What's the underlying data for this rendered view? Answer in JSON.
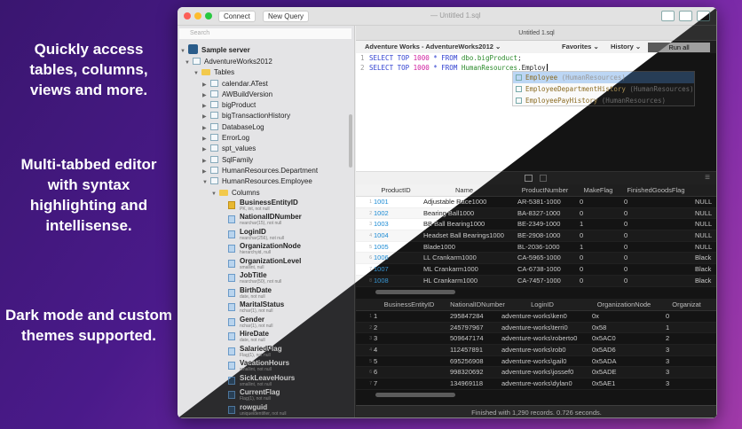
{
  "promo": [
    "Quickly access tables, columns, views and more.",
    "Multi-tabbed editor with syntax highlighting and intellisense.",
    "Dark mode and custom themes supported."
  ],
  "window": {
    "title": "— Untitled 1.sql",
    "connect": "Connect",
    "new_query": "New Query"
  },
  "sidebar": {
    "search_placeholder": "Search",
    "server": "Sample server",
    "database": "AdventureWorks2012",
    "tables_folder": "Tables",
    "tables": [
      "calendar.ATest",
      "AWBuildVersion",
      "bigProduct",
      "bigTransactionHistory",
      "DatabaseLog",
      "ErrorLog",
      "spt_values",
      "SqlFamily",
      "HumanResources.Department",
      "HumanResources.Employee"
    ],
    "columns_folder": "Columns",
    "columns": [
      {
        "name": "BusinessEntityID",
        "type": "PK, int, not null"
      },
      {
        "name": "NationalIDNumber",
        "type": "nvarchar(15), not null"
      },
      {
        "name": "LoginID",
        "type": "nvarchar(256), not null"
      },
      {
        "name": "OrganizationNode",
        "type": "hierarchyid, null"
      },
      {
        "name": "OrganizationLevel",
        "type": "smallint, null"
      },
      {
        "name": "JobTitle",
        "type": "nvarchar(50), not null"
      },
      {
        "name": "BirthDate",
        "type": "date, not null"
      },
      {
        "name": "MaritalStatus",
        "type": "nchar(1), not null"
      },
      {
        "name": "Gender",
        "type": "nchar(1), not null"
      },
      {
        "name": "HireDate",
        "type": "date, not null"
      },
      {
        "name": "SalariedFlag",
        "type": "Flag(1), not null"
      },
      {
        "name": "VacationHours",
        "type": "smallint, not null"
      },
      {
        "name": "SickLeaveHours",
        "type": "smallint, not null"
      },
      {
        "name": "CurrentFlag",
        "type": "Flag(1), not null"
      },
      {
        "name": "rowguid",
        "type": "uniqueidentifier, not null"
      }
    ]
  },
  "tab": "Untitled 1.sql",
  "query_bar": {
    "connection": "Adventure Works - AdventureWorks2012",
    "favorites": "Favorites",
    "history": "History",
    "run_all": "Run all"
  },
  "editor": {
    "lines": [
      {
        "n": "1",
        "kw": "SELECT TOP ",
        "num": "1000",
        "mid": " * FROM ",
        "id": "dbo.bigProduct",
        "rest": ";"
      },
      {
        "n": "2",
        "kw": "SELECT TOP ",
        "num": "1000",
        "mid": " * FROM ",
        "id": "HumanResources.",
        "rest": "Employ"
      }
    ]
  },
  "autocomplete": [
    {
      "name": "Employee",
      "hint": "(HumanResources)"
    },
    {
      "name": "EmployeeDepartmentHistory",
      "hint": "(HumanResources)"
    },
    {
      "name": "EmployeePayHistory",
      "hint": "(HumanResources)"
    }
  ],
  "grid1": {
    "headers": [
      "ProductID",
      "Name",
      "ProductNumber",
      "MakeFlag",
      "FinishedGoodsFlag",
      ""
    ],
    "rows": [
      [
        "1001",
        "Adjustable Race1000",
        "AR-5381-1000",
        "0",
        "0",
        "NULL"
      ],
      [
        "1002",
        "Bearing Ball1000",
        "BA-8327-1000",
        "0",
        "0",
        "NULL"
      ],
      [
        "1003",
        "BB Ball Bearing1000",
        "BE-2349-1000",
        "1",
        "0",
        "NULL"
      ],
      [
        "1004",
        "Headset Ball Bearings1000",
        "BE-2908-1000",
        "0",
        "0",
        "NULL"
      ],
      [
        "1005",
        "Blade1000",
        "BL-2036-1000",
        "1",
        "0",
        "NULL"
      ],
      [
        "1006",
        "LL Crankarm1000",
        "CA-5965-1000",
        "0",
        "0",
        "Black"
      ],
      [
        "1007",
        "ML Crankarm1000",
        "CA-6738-1000",
        "0",
        "0",
        "Black"
      ],
      [
        "1008",
        "HL Crankarm1000",
        "CA-7457-1000",
        "0",
        "0",
        "Black"
      ]
    ]
  },
  "grid2": {
    "headers": [
      "BusinessEntityID",
      "NationalIDNumber",
      "LoginID",
      "OrganizationNode",
      "Organizat"
    ],
    "rows": [
      [
        "1",
        "295847284",
        "adventure-works\\ken0",
        "0x",
        "0"
      ],
      [
        "2",
        "245797967",
        "adventure-works\\terri0",
        "0x58",
        "1"
      ],
      [
        "3",
        "509647174",
        "adventure-works\\roberto0",
        "0x5AC0",
        "2"
      ],
      [
        "4",
        "112457891",
        "adventure-works\\rob0",
        "0x5AD6",
        "3"
      ],
      [
        "5",
        "695256908",
        "adventure-works\\gail0",
        "0x5ADA",
        "3"
      ],
      [
        "6",
        "998320692",
        "adventure-works\\jossef0",
        "0x5ADE",
        "3"
      ],
      [
        "7",
        "134969118",
        "adventure-works\\dylan0",
        "0x5AE1",
        "3"
      ]
    ]
  },
  "status": "Finished with 1,290 records. 0.726 seconds."
}
